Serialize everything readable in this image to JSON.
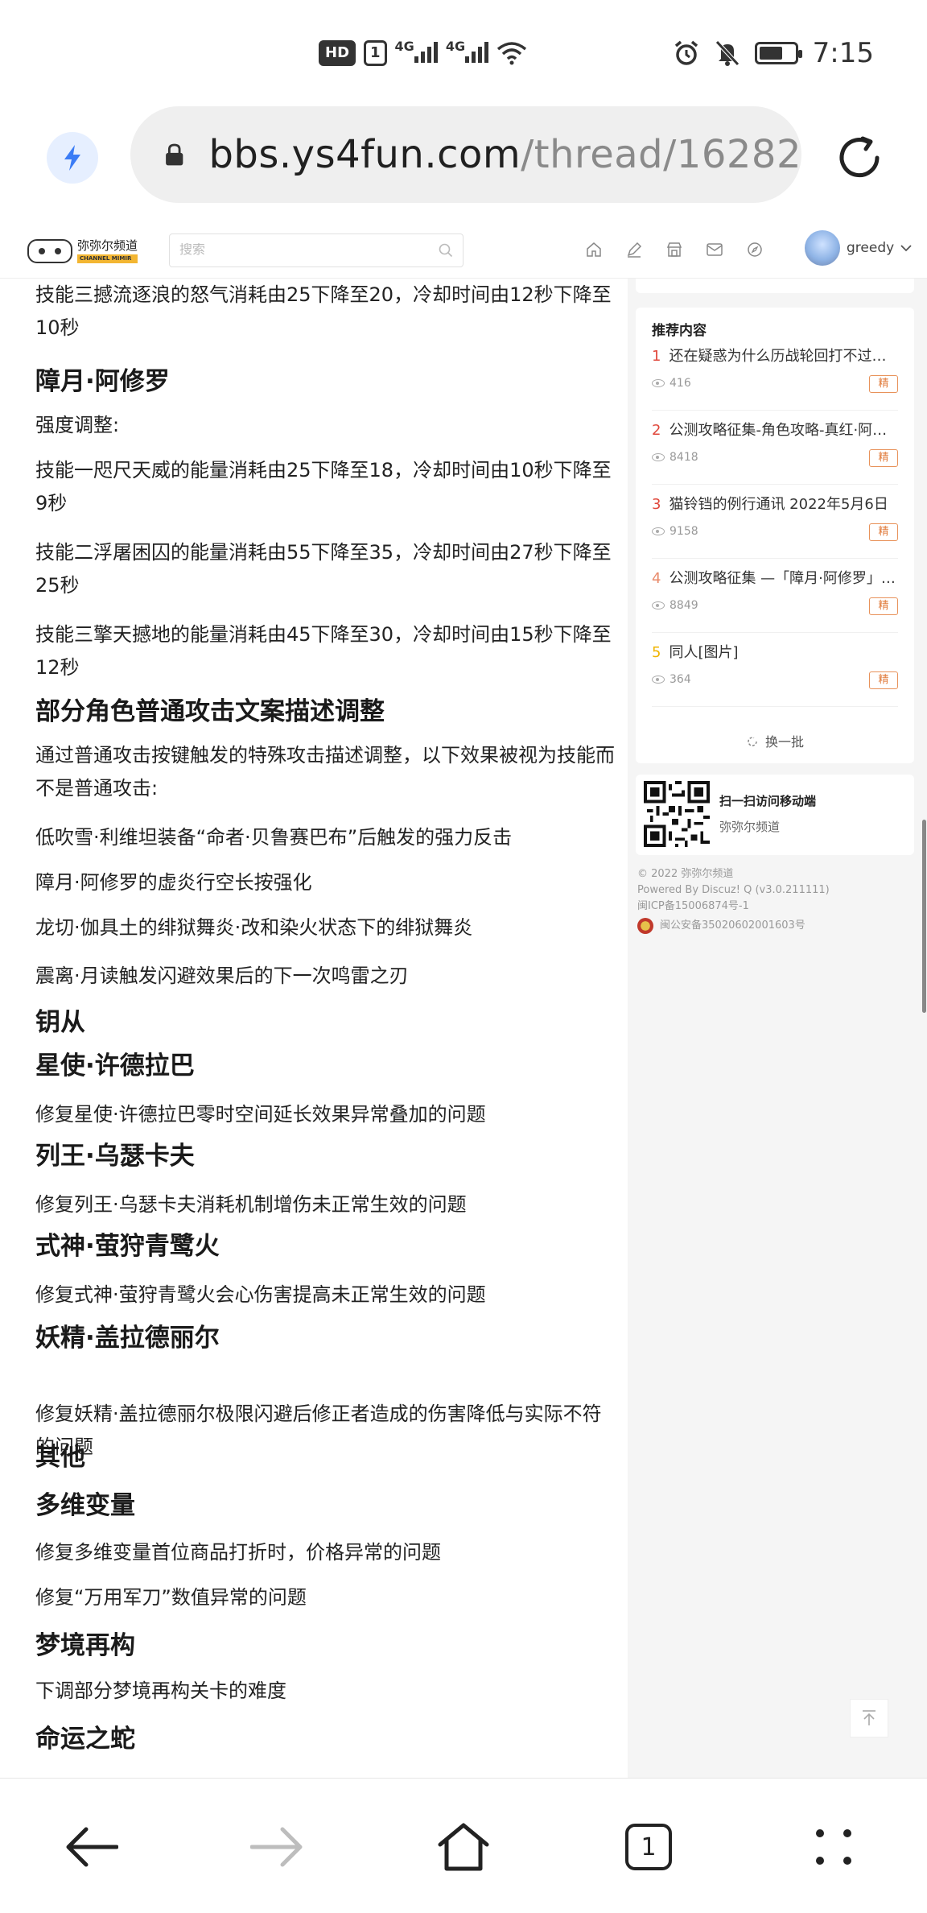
{
  "status_bar": {
    "hd": "HD",
    "sim": "1",
    "net1": "4G",
    "net2": "4G",
    "time": "7:15"
  },
  "browser": {
    "url_host": "bbs.ys4fun.com",
    "url_path": "/thread/16282"
  },
  "site": {
    "logo_cn": "弥弥尔频道",
    "logo_en": "CHANNEL MIMIR",
    "search_placeholder": "搜索",
    "username": "greedy"
  },
  "article": [
    {
      "kind": "p",
      "text": "技能三撼流逐浪的怒气消耗由25下降至20，冷却时间由12秒下降至10秒"
    },
    {
      "kind": "h",
      "text": "障月·阿修罗"
    },
    {
      "kind": "p",
      "text": "强度调整:"
    },
    {
      "kind": "p",
      "text": "技能一咫尺天威的能量消耗由25下降至18，冷却时间由10秒下降至9秒"
    },
    {
      "kind": "p",
      "text": "技能二浮屠困囚的能量消耗由55下降至35，冷却时间由27秒下降至25秒"
    },
    {
      "kind": "p",
      "text": "技能三擎天撼地的能量消耗由45下降至30，冷却时间由15秒下降至12秒"
    },
    {
      "kind": "h",
      "text": "部分角色普通攻击文案描述调整"
    },
    {
      "kind": "p",
      "text": "通过普通攻击按键触发的特殊攻击描述调整，以下效果被视为技能而不是普通攻击:"
    },
    {
      "kind": "p",
      "text": "低吹雪·利维坦装备“命者·贝鲁赛巴布”后触发的强力反击"
    },
    {
      "kind": "p",
      "text": "障月·阿修罗的虚炎行空长按强化"
    },
    {
      "kind": "p",
      "text": "龙切·伽具土的绯狱舞炎·改和染火状态下的绯狱舞炎"
    },
    {
      "kind": "p",
      "text": "震离·月读触发闪避效果后的下一次鸣雷之刃"
    },
    {
      "kind": "h",
      "text": "钥从"
    },
    {
      "kind": "h",
      "text": "星使·许德拉巴"
    },
    {
      "kind": "p",
      "text": "修复星使·许德拉巴零时空间延长效果异常叠加的问题"
    },
    {
      "kind": "h",
      "text": "列王·乌瑟卡夫"
    },
    {
      "kind": "p",
      "text": "修复列王·乌瑟卡夫消耗机制增伤未正常生效的问题"
    },
    {
      "kind": "h",
      "text": "式神·萤狩青鹭火"
    },
    {
      "kind": "p",
      "text": "修复式神·萤狩青鹭火会心伤害提高未正常生效的问题"
    },
    {
      "kind": "h",
      "text": "妖精·盖拉德丽尔"
    },
    {
      "kind": "p",
      "text": "修复妖精·盖拉德丽尔极限闪避后修正者造成的伤害降低与实际不符的问题"
    },
    {
      "kind": "h",
      "text": "其他"
    },
    {
      "kind": "h",
      "text": "多维变量"
    },
    {
      "kind": "p",
      "text": "修复多维变量首位商品打折时，价格异常的问题"
    },
    {
      "kind": "p",
      "text": "修复“万用军刀”数值异常的问题"
    },
    {
      "kind": "h",
      "text": "梦境再构"
    },
    {
      "kind": "p",
      "text": "下调部分梦境再构关卡的难度"
    },
    {
      "kind": "h",
      "text": "命运之蛇"
    }
  ],
  "sidebar": {
    "rec_title": "推荐内容",
    "items": [
      {
        "num": "1",
        "title": "还在疑惑为什么历战轮回打不过的，进来看看吧",
        "views": "416",
        "badge": "精",
        "num_color": "#e0483c"
      },
      {
        "num": "2",
        "title": "公测攻略征集-角色攻略-真红·阿修罗",
        "views": "8418",
        "badge": "精",
        "num_color": "#e0483c"
      },
      {
        "num": "3",
        "title": "猫铃铛的例行通讯 2022年5月6日",
        "views": "9158",
        "badge": "精",
        "num_color": "#e0483c"
      },
      {
        "num": "4",
        "title": "公测攻略征集 —「障月·阿修罗」攻略",
        "views": "8849",
        "badge": "精",
        "num_color": "#e98a6a"
      },
      {
        "num": "5",
        "title": "同人[图片]",
        "views": "364",
        "badge": "精",
        "num_color": "#f0b400"
      }
    ],
    "swap_label": "换一批",
    "qr_title": "扫一扫访问移动端",
    "qr_sub": "弥弥尔频道",
    "footer": {
      "copyright": "© 2022 弥弥尔频道",
      "powered": "Powered By Discuz! Q (v3.0.211111)",
      "icp": "闽ICP备15006874号-1",
      "gongan": "闽公安备35020602001603号"
    }
  },
  "tabs": {
    "count": "1"
  },
  "colors": {
    "accent": "#3b7cf5",
    "badge": "#e07a3a"
  }
}
